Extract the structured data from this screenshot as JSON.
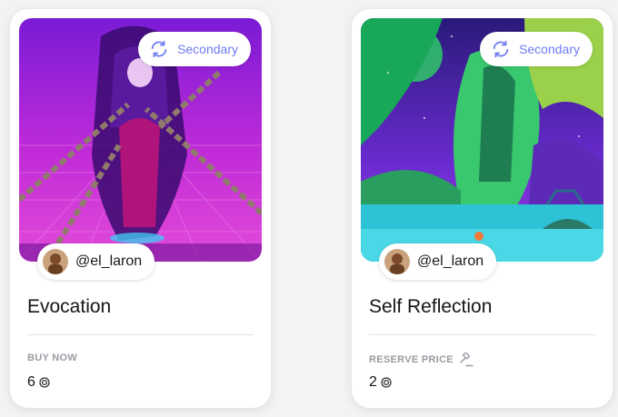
{
  "cards": [
    {
      "badge": "Secondary",
      "creator": "@el_laron",
      "title": "Evocation",
      "label": "BUY NOW",
      "price": "6",
      "art_icon": "purple-reaper-artwork"
    },
    {
      "badge": "Secondary",
      "creator": "@el_laron",
      "title": "Self Reflection",
      "label": "RESERVE PRICE",
      "price": "2",
      "art_icon": "green-jungle-artwork"
    }
  ],
  "colors": {
    "accent": "#6f7bf2",
    "muted_label": "#9a9aa2",
    "card_bg": "#ffffff",
    "page_bg": "#f3f3f5"
  }
}
